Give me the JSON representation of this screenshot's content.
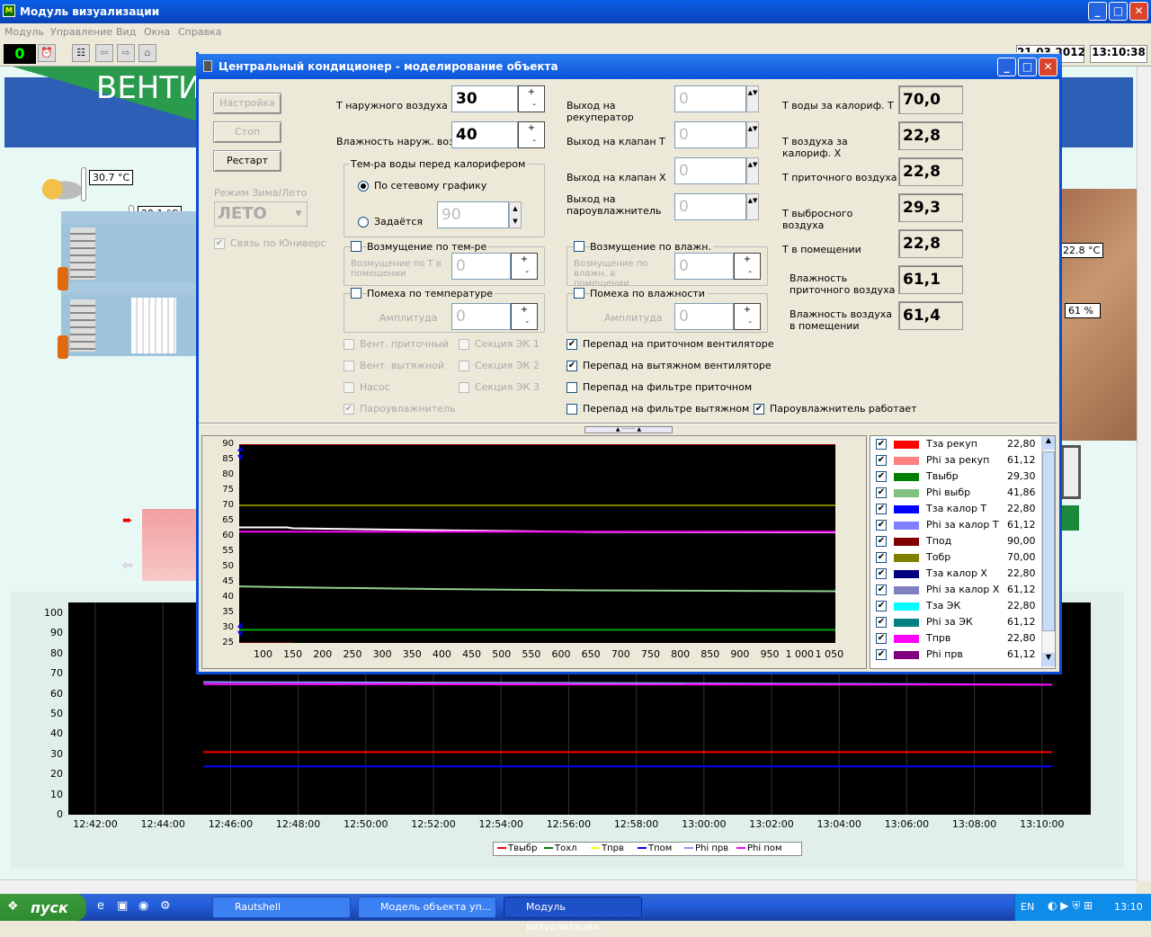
{
  "app": {
    "title": "Модуль визуализации"
  },
  "menu": [
    "Модуль",
    "Управление",
    "Вид",
    "Окна",
    "Справка"
  ],
  "toolbar": {
    "counter": "0",
    "date": "21.03.2012",
    "time": "13:10:38"
  },
  "banner": {
    "text": "ВЕНТИ"
  },
  "scene": {
    "outdoor_temp": "30.7 °C",
    "inner_temp": "29.1 °C",
    "right_temp": "22.8 °C",
    "right_hum": "61 %"
  },
  "dialog": {
    "title": "Центральный кондиционер - моделирование объекта",
    "buttons": {
      "setup": "Настройка",
      "stop": "Стоп",
      "restart": "Рестарт"
    },
    "mode": {
      "label": "Режим Зима/Лето",
      "value": "ЛЕТО",
      "link_label": "Связь по Юниверс"
    },
    "outdoor": {
      "temp_label": "Т наружного воздуха",
      "temp_value": "30",
      "hum_label": "Влажность наруж. возд.",
      "hum_value": "40"
    },
    "water": {
      "group_label": "Тем-ра воды перед калорифером",
      "opt1": "По сетевому графику",
      "opt2": "Задаётся",
      "value": "90"
    },
    "dist_temp": {
      "label": "Возмущение по тем-ре",
      "sub": "Возмущение по Т в помещении",
      "value": "0"
    },
    "noise_temp": {
      "label": "Помеха по температуре",
      "sub": "Амплитуда",
      "value": "0"
    },
    "dist_hum": {
      "label": "Возмущение по влажн.",
      "sub": "Возмущение по влажн. в помещении",
      "value": "0"
    },
    "noise_hum": {
      "label": "Помеха по влажности",
      "sub": "Амплитуда",
      "value": "0"
    },
    "outputs": [
      {
        "label": "Выход на рекуператор",
        "value": "0"
      },
      {
        "label": "Выход на клапан Т",
        "value": "0"
      },
      {
        "label": "Выход на клапан Х",
        "value": "0"
      },
      {
        "label": "Выход на пароувлажнитель",
        "value": "0"
      }
    ],
    "readouts": [
      {
        "label": "Т воды за калориф. Т",
        "value": "70,0"
      },
      {
        "label": "Т воздуха за калориф. Х",
        "value": "22,8"
      },
      {
        "label": "Т приточного воздуха",
        "value": "22,8"
      },
      {
        "label": "Т выбросного воздуха",
        "value": "29,3"
      },
      {
        "label": "Т в помещении",
        "value": "22,8"
      },
      {
        "label": "Влажность приточного воздуха",
        "value": "61,1"
      },
      {
        "label": "Влажность воздуха в помещении",
        "value": "61,4"
      }
    ],
    "disabled_checks": [
      "Вент. приточный",
      "Вент. вытяжной",
      "Насос",
      "Пароувлажнитель",
      "Секция ЭК 1",
      "Секция ЭК 2",
      "Секция ЭК 3"
    ],
    "checks": [
      {
        "label": "Перепад на приточном вентиляторе",
        "checked": true
      },
      {
        "label": "Перепад на вытяжном вентиляторе",
        "checked": true
      },
      {
        "label": "Перепад на фильтре приточном",
        "checked": false
      },
      {
        "label": "Перепад на фильтре вытяжном",
        "checked": false
      }
    ],
    "humidifier_check": "Пароувлажнитель работает"
  },
  "chart_data": [
    {
      "type": "line",
      "y_ticks": [
        90,
        85,
        80,
        75,
        70,
        65,
        60,
        55,
        50,
        45,
        40,
        35,
        30,
        25
      ],
      "x_ticks": [
        "100",
        "150",
        "200",
        "250",
        "300",
        "350",
        "400",
        "450",
        "500",
        "550",
        "600",
        "650",
        "700",
        "750",
        "800",
        "850",
        "900",
        "950",
        "1 000",
        "1 050"
      ],
      "ylim": [
        25,
        90
      ],
      "xlim": [
        60,
        1060
      ],
      "series": [
        {
          "name": "Тпод",
          "color": "#8B0000",
          "x": [
            60,
            1060
          ],
          "values": [
            90,
            90
          ]
        },
        {
          "name": "Тобр",
          "color": "#808000",
          "x": [
            60,
            1060
          ],
          "values": [
            70,
            70
          ]
        },
        {
          "name": "Phi за рекуп",
          "color": "#ffffff",
          "x": [
            60,
            140,
            150,
            260,
            420,
            650,
            1060
          ],
          "values": [
            62.8,
            62.8,
            62.5,
            62.2,
            61.8,
            61.3,
            61.2
          ]
        },
        {
          "name": "Phi пом",
          "color": "#ff00ff",
          "x": [
            60,
            1060
          ],
          "values": [
            61.4,
            61.4
          ]
        },
        {
          "name": "Phi выбр",
          "color": "#90D090",
          "x": [
            60,
            150,
            400,
            650,
            1060
          ],
          "values": [
            43.5,
            43.2,
            42.6,
            42.2,
            41.9
          ]
        },
        {
          "name": "Твыбр",
          "color": "#00A000",
          "x": [
            60,
            1060
          ],
          "values": [
            29.3,
            29.3
          ]
        },
        {
          "name": "Тза рекуп",
          "color": "#ff0000",
          "x": [
            60,
            150
          ],
          "values": [
            24.8,
            24.8
          ]
        },
        {
          "name": "Тпрв",
          "color": "#ffff00",
          "x": [
            60,
            1060
          ],
          "values": [
            24.2,
            24.2
          ]
        }
      ]
    },
    {
      "type": "line",
      "y_ticks": [
        100,
        90,
        80,
        70,
        60,
        50,
        40,
        30,
        20,
        10,
        0
      ],
      "x_ticks": [
        "12:42:00",
        "12:44:00",
        "12:46:00",
        "12:48:00",
        "12:50:00",
        "12:52:00",
        "12:54:00",
        "12:56:00",
        "12:58:00",
        "13:00:00",
        "13:02:00",
        "13:04:00",
        "13:06:00",
        "13:08:00",
        "13:10:00"
      ],
      "ylim": [
        0,
        100
      ],
      "series": [
        {
          "name": "Твыбр",
          "color": "#ff0000",
          "x": [
            12.9,
            15.1
          ],
          "values": [
            29.5,
            29.5
          ]
        },
        {
          "name": "Тохл",
          "color": "#008000",
          "x": [],
          "values": []
        },
        {
          "name": "Тпрв",
          "color": "#ffff00",
          "x": [],
          "values": []
        },
        {
          "name": "Тпом",
          "color": "#0000ff",
          "x": [
            12.9,
            15.1
          ],
          "values": [
            22.8,
            22.8
          ]
        },
        {
          "name": "Phi прв",
          "color": "#9090ff",
          "x": [
            12.9,
            14.0,
            15.1
          ],
          "values": [
            62.5,
            62.0,
            61.3
          ]
        },
        {
          "name": "Phi пом",
          "color": "#ff00ff",
          "x": [
            12.9,
            15.1
          ],
          "values": [
            61.5,
            61.3
          ]
        }
      ]
    }
  ],
  "legend": [
    {
      "name": "Тза рекуп",
      "color": "#ff0000",
      "value": "22,80"
    },
    {
      "name": "Phi за рекуп",
      "color": "#ff8080",
      "value": "61,12"
    },
    {
      "name": "Твыбр",
      "color": "#008000",
      "value": "29,30"
    },
    {
      "name": "Phi выбр",
      "color": "#80c080",
      "value": "41,86"
    },
    {
      "name": "Тза калор Т",
      "color": "#0000ff",
      "value": "22,80"
    },
    {
      "name": "Phi за калор Т",
      "color": "#8080ff",
      "value": "61,12"
    },
    {
      "name": "Тпод",
      "color": "#800000",
      "value": "90,00"
    },
    {
      "name": "Тобр",
      "color": "#808000",
      "value": "70,00"
    },
    {
      "name": "Тза калор Х",
      "color": "#000080",
      "value": "22,80"
    },
    {
      "name": "Phi за калор Х",
      "color": "#8080c0",
      "value": "61,12"
    },
    {
      "name": "Тза ЭК",
      "color": "#00ffff",
      "value": "22,80"
    },
    {
      "name": "Phi за ЭК",
      "color": "#008080",
      "value": "61,12"
    },
    {
      "name": "Тпрв",
      "color": "#ff00ff",
      "value": "22,80"
    },
    {
      "name": "Phi прв",
      "color": "#800080",
      "value": "61,12"
    }
  ],
  "taskbar": {
    "start": "пуск",
    "tasks": [
      "Rautshell",
      "Модель объекта уп...",
      "Модуль визуализации"
    ],
    "lang": "EN",
    "clock": "13:10"
  }
}
